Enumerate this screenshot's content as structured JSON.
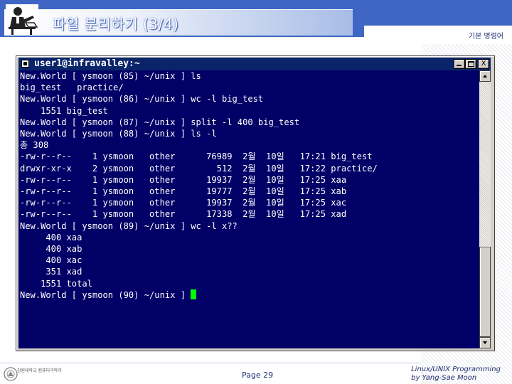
{
  "slide": {
    "title": "파일 분리하기 (3/4)",
    "subtitle": "기본 명령어",
    "page_label": "Page 29",
    "course_line1": "Linux/UNIX Programming",
    "course_line2": "by Yang-Sae Moon",
    "footer_logo_text": "강원대학교 컴퓨터과학과"
  },
  "terminal": {
    "title": "user1@infravalley:~",
    "buttons": {
      "minimize": "minimize",
      "maximize": "maximize",
      "close": "X"
    },
    "lines": [
      "New.World [ ysmoon (85) ~/unix ] ls",
      "big_test   practice/",
      "New.World [ ysmoon (86) ~/unix ] wc -l big_test",
      "    1551 big_test",
      "New.World [ ysmoon (87) ~/unix ] split -l 400 big_test",
      "New.World [ ysmoon (88) ~/unix ] ls -l",
      "총 308",
      "-rw-r--r--    1 ysmoon   other      76989  2월  10일   17:21 big_test",
      "drwxr-xr-x    2 ysmoon   other        512  2월  10일   17:22 practice/",
      "-rw-r--r--    1 ysmoon   other      19937  2월  10일   17:25 xaa",
      "-rw-r--r--    1 ysmoon   other      19777  2월  10일   17:25 xab",
      "-rw-r--r--    1 ysmoon   other      19937  2월  10일   17:25 xac",
      "-rw-r--r--    1 ysmoon   other      17338  2월  10일   17:25 xad",
      "New.World [ ysmoon (89) ~/unix ] wc -l x??",
      "     400 xaa",
      "     400 xab",
      "     400 xac",
      "     351 xad",
      "    1551 total"
    ],
    "prompt_line": "New.World [ ysmoon (90) ~/unix ] "
  },
  "colors": {
    "header_blue": "#3f66c4",
    "terminal_bg": "#000066",
    "terminal_fg": "#ffffff",
    "cursor": "#00ff00",
    "titlebar": "#0a246a"
  },
  "icons": {
    "header": "presenter-at-desk-icon",
    "window": "terminal-window-icon"
  }
}
